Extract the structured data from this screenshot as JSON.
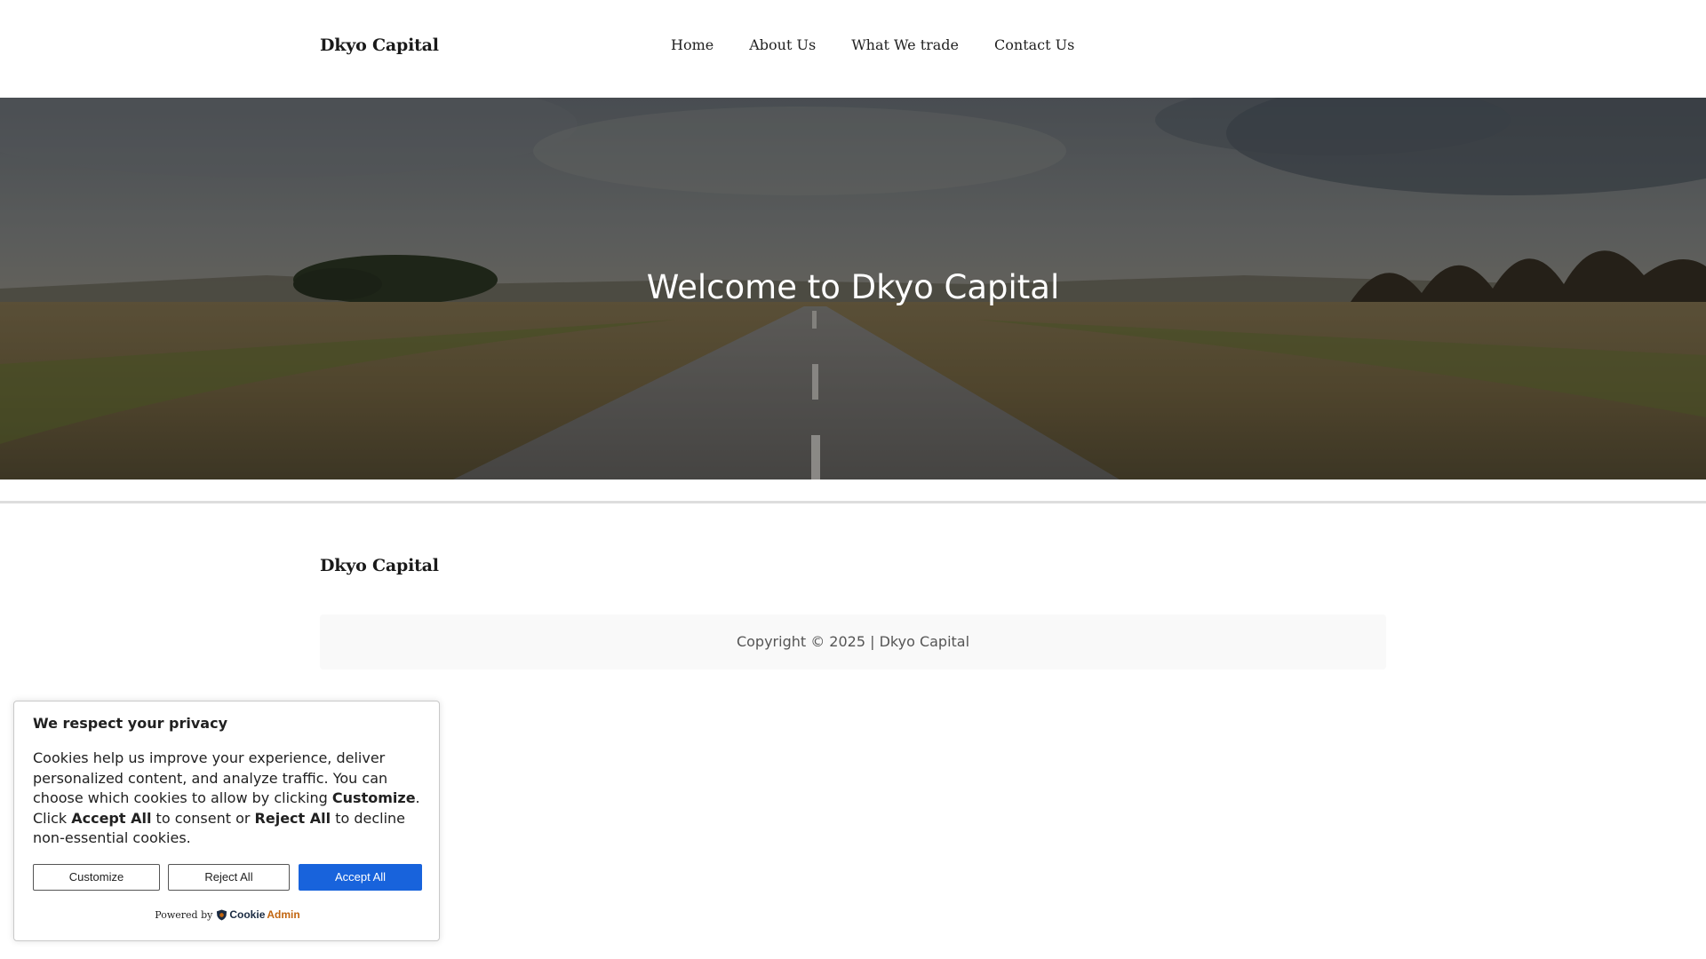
{
  "header": {
    "logo": "Dkyo Capital",
    "nav": [
      {
        "label": "Home"
      },
      {
        "label": "About Us"
      },
      {
        "label": "What We trade"
      },
      {
        "label": "Contact Us"
      }
    ]
  },
  "hero": {
    "title": "Welcome to Dkyo Capital"
  },
  "footer": {
    "logo": "Dkyo Capital",
    "copyright": "Copyright © 2025 | Dkyo Capital"
  },
  "cookie_banner": {
    "title": "We respect your privacy",
    "description": {
      "part1": "Cookies help us improve your experience, deliver personalized content, and analyze traffic. You can choose which cookies to allow by clicking ",
      "customize_word": "Customize",
      "part2": ". Click ",
      "accept_word": "Accept All",
      "part3": " to consent or ",
      "reject_word": "Reject All",
      "part4": " to decline non-essential cookies."
    },
    "buttons": {
      "customize": "Customize",
      "reject": "Reject All",
      "accept": "Accept All"
    },
    "powered_by": "Powered by",
    "brand": {
      "part1": "Cookie",
      "part2": "Admin"
    },
    "colors": {
      "accept_bg": "#1863dc",
      "brand_dark": "#1b2b42",
      "brand_accent": "#c2650f"
    }
  }
}
